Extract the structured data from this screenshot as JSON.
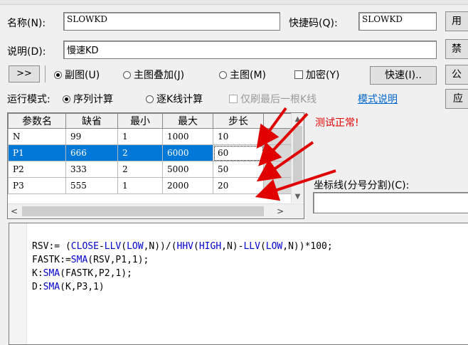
{
  "form": {
    "name_label": "名称(N):",
    "name_value": "SLOWKD",
    "shortcut_label": "快捷码(Q):",
    "shortcut_value": "SLOWKD",
    "desc_label": "说明(D):",
    "desc_value": "慢速KD"
  },
  "side_buttons": [
    "用",
    "禁",
    "公",
    "应"
  ],
  "chart_mode": {
    "expand_label": ">>",
    "options": [
      "副图(U)",
      "主图叠加(J)",
      "主图(M)"
    ],
    "selected": 0,
    "encrypt_label": "加密(Y)",
    "fast_label": "快速(I).."
  },
  "run_mode": {
    "label": "运行模式:",
    "options": [
      "序列计算",
      "逐K线计算"
    ],
    "selected": 0,
    "refresh_label": "仅刷最后一根K线",
    "help_link": "模式说明"
  },
  "params": {
    "headers": [
      "参数名",
      "缺省",
      "最小",
      "最大",
      "步长"
    ],
    "rows": [
      [
        "N",
        "99",
        "1",
        "1000",
        "10"
      ],
      [
        "P1",
        "666",
        "2",
        "6000",
        "60"
      ],
      [
        "P2",
        "333",
        "2",
        "5000",
        "50"
      ],
      [
        "P3",
        "555",
        "1",
        "2000",
        "20"
      ]
    ],
    "selected_row": 1
  },
  "annotation": "测试正常!",
  "axis_label": "坐标线(分号分割)(C):",
  "code_lines": [
    "RSV:= (CLOSE-LLV(LOW,N))/(HHV(HIGH,N)-LLV(LOW,N))*100;",
    "FASTK:=SMA(RSV,P1,1);",
    "K:SMA(FASTK,P2,1);",
    "D:SMA(K,P3,1)"
  ],
  "colors": {
    "selection": "#0078d7",
    "annotation": "#e00000",
    "keyword": "#0000cc"
  }
}
